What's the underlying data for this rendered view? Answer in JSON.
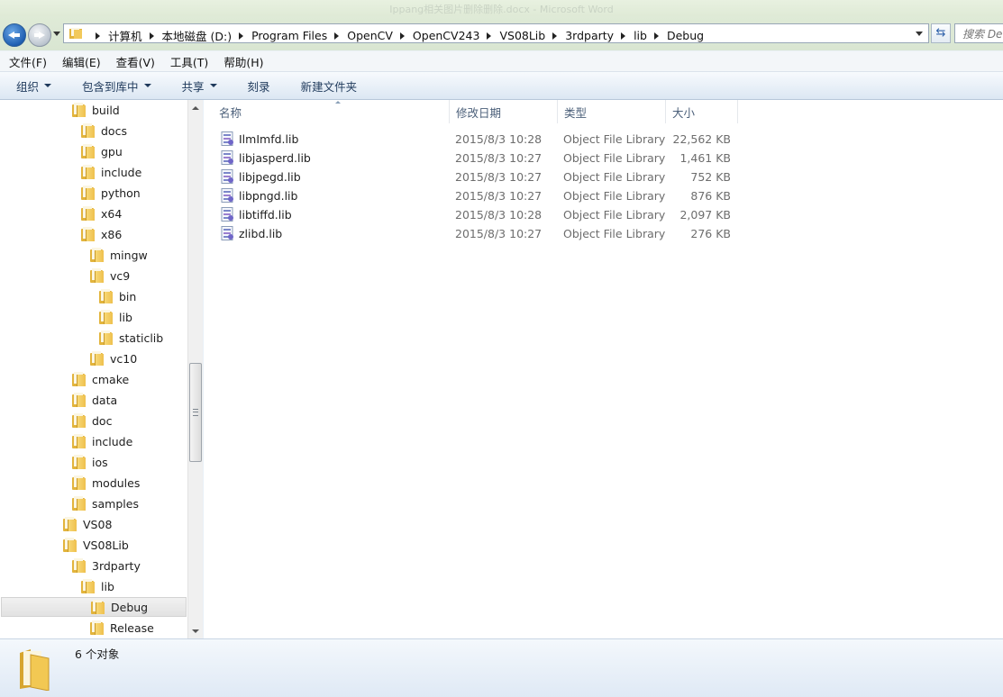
{
  "window": {
    "title": "Ippang相关图片删除删除.docx - Microsoft Word"
  },
  "address": {
    "crumbs": [
      "计算机",
      "本地磁盘 (D:)",
      "Program Files",
      "OpenCV",
      "OpenCV243",
      "VS08Lib",
      "3rdparty",
      "lib",
      "Debug"
    ],
    "search_placeholder": "搜索 Deb"
  },
  "menubar": {
    "items": [
      "文件(F)",
      "编辑(E)",
      "查看(V)",
      "工具(T)",
      "帮助(H)"
    ]
  },
  "commandbar": {
    "organize": "组织",
    "include_in_library": "包含到库中",
    "share": "共享",
    "burn": "刻录",
    "new_folder": "新建文件夹"
  },
  "navpane": {
    "items": [
      {
        "label": "build",
        "level": 0
      },
      {
        "label": "docs",
        "level": 1
      },
      {
        "label": "gpu",
        "level": 1
      },
      {
        "label": "include",
        "level": 1
      },
      {
        "label": "python",
        "level": 1
      },
      {
        "label": "x64",
        "level": 1
      },
      {
        "label": "x86",
        "level": 1
      },
      {
        "label": "mingw",
        "level": 2
      },
      {
        "label": "vc9",
        "level": 2
      },
      {
        "label": "bin",
        "level": 3
      },
      {
        "label": "lib",
        "level": 3
      },
      {
        "label": "staticlib",
        "level": 3
      },
      {
        "label": "vc10",
        "level": 2
      },
      {
        "label": "cmake",
        "level": 0
      },
      {
        "label": "data",
        "level": 0
      },
      {
        "label": "doc",
        "level": 0
      },
      {
        "label": "include",
        "level": 0
      },
      {
        "label": "ios",
        "level": 0
      },
      {
        "label": "modules",
        "level": 0
      },
      {
        "label": "samples",
        "level": 0
      },
      {
        "label": "VS08",
        "level": -1
      },
      {
        "label": "VS08Lib",
        "level": -1
      },
      {
        "label": "3rdparty",
        "level": 0
      },
      {
        "label": "lib",
        "level": 1
      },
      {
        "label": "Debug",
        "level": 2,
        "selected": true
      },
      {
        "label": "Release",
        "level": 2
      }
    ]
  },
  "columns": {
    "name": "名称",
    "date": "修改日期",
    "type": "类型",
    "size": "大小"
  },
  "files": [
    {
      "name": "IlmImfd.lib",
      "date": "2015/8/3 10:28",
      "type": "Object File Library",
      "size": "22,562 KB"
    },
    {
      "name": "libjasperd.lib",
      "date": "2015/8/3 10:27",
      "type": "Object File Library",
      "size": "1,461 KB"
    },
    {
      "name": "libjpegd.lib",
      "date": "2015/8/3 10:27",
      "type": "Object File Library",
      "size": "752 KB"
    },
    {
      "name": "libpngd.lib",
      "date": "2015/8/3 10:27",
      "type": "Object File Library",
      "size": "876 KB"
    },
    {
      "name": "libtiffd.lib",
      "date": "2015/8/3 10:28",
      "type": "Object File Library",
      "size": "2,097 KB"
    },
    {
      "name": "zlibd.lib",
      "date": "2015/8/3 10:27",
      "type": "Object File Library",
      "size": "276 KB"
    }
  ],
  "status": {
    "count_text": "6 个对象"
  }
}
